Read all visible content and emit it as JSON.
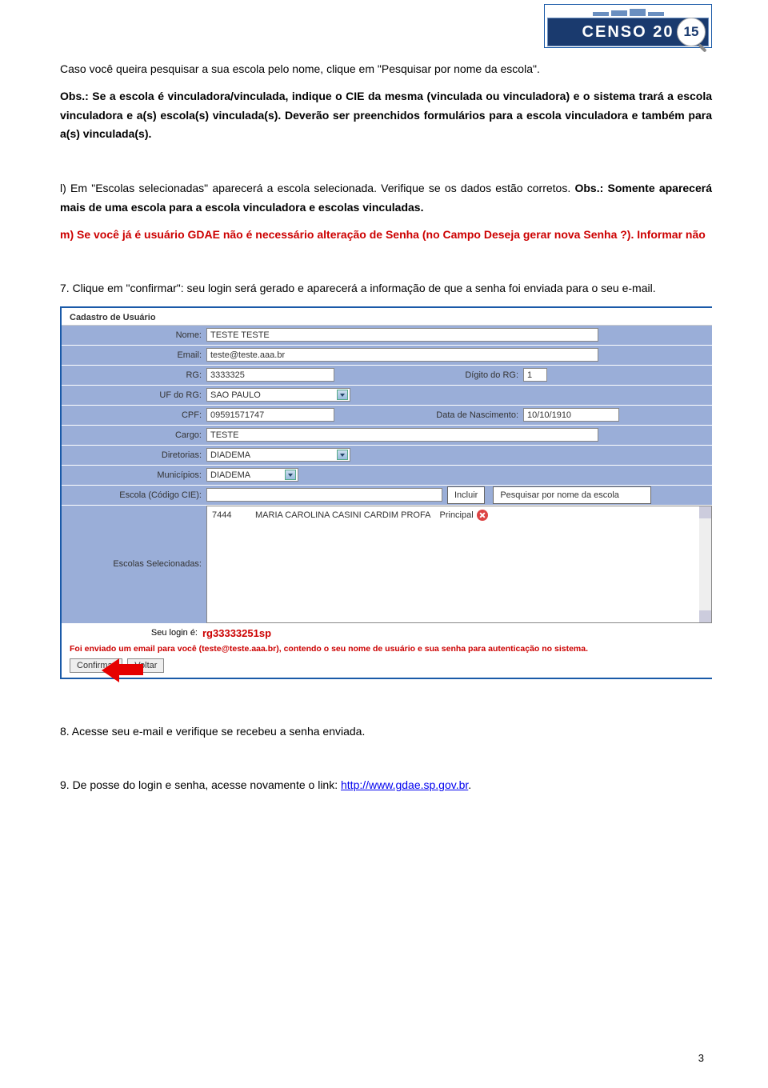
{
  "logo": {
    "text": "CENSO 20",
    "year_suffix": "15"
  },
  "paragraphs": {
    "p1": "Caso você queira pesquisar a sua escola pelo nome, clique em \"Pesquisar por nome da escola\".",
    "p2": "Obs.: Se a escola é vinculadora/vinculada, indique o CIE da mesma (vinculada ou vinculadora) e o sistema trará a escola vinculadora e a(s) escola(s) vinculada(s). Deverão ser preenchidos formulários para a escola vinculadora e também para a(s) vinculada(s).",
    "p3a": "l) Em \"Escolas selecionadas\" aparecerá a escola selecionada. Verifique se os dados estão corretos. ",
    "p3b": "Obs.: Somente aparecerá mais de uma escola para a escola vinculadora e escolas vinculadas.",
    "p4": "m) Se você já é usuário GDAE não é necessário alteração de Senha (no Campo Deseja gerar nova Senha ?). Informar não",
    "p5": "7. Clique em \"confirmar\": seu login será gerado e aparecerá a informação de que a senha foi enviada para o seu e-mail.",
    "p6": "8. Acesse seu e-mail e verifique se recebeu a senha enviada.",
    "p7_prefix": "9. De posse do login e senha, acesse novamente o link: ",
    "p7_link": "http://www.gdae.sp.gov.br",
    "p7_suffix": "."
  },
  "form": {
    "section_title": "Cadastro de Usuário",
    "rows": {
      "nome": {
        "label": "Nome:",
        "value": "TESTE TESTE"
      },
      "email": {
        "label": "Email:",
        "value": "teste@teste.aaa.br"
      },
      "rg": {
        "label": "RG:",
        "value": "3333325",
        "dig_label": "Dígito do RG:",
        "dig_value": "1"
      },
      "uf": {
        "label": "UF do RG:",
        "value": "SAO PAULO"
      },
      "cpf": {
        "label": "CPF:",
        "value": "09591571747",
        "dn_label": "Data de Nascimento:",
        "dn_value": "10/10/1910"
      },
      "cargo": {
        "label": "Cargo:",
        "value": "TESTE"
      },
      "diretorias": {
        "label": "Diretorias:",
        "value": "DIADEMA"
      },
      "municipios": {
        "label": "Municípios:",
        "value": "DIADEMA"
      },
      "cie": {
        "label": "Escola (Código CIE):",
        "value": "",
        "btn_incluir": "Incluir",
        "btn_pesq": "Pesquisar por nome da escola"
      },
      "escolas": {
        "label": "Escolas Selecionadas:",
        "line_code": "7444",
        "line_name": "MARIA CAROLINA CASINI CARDIM PROFA",
        "line_role": "Principal"
      },
      "login": {
        "label": "Seu login é:",
        "value": "rg33333251sp"
      }
    },
    "msg": "Foi enviado um email para você (teste@teste.aaa.br), contendo o seu nome de usuário e sua senha para autenticação no sistema.",
    "btn_confirmar": "Confirmar",
    "btn_voltar": "Voltar"
  },
  "page_number": "3"
}
